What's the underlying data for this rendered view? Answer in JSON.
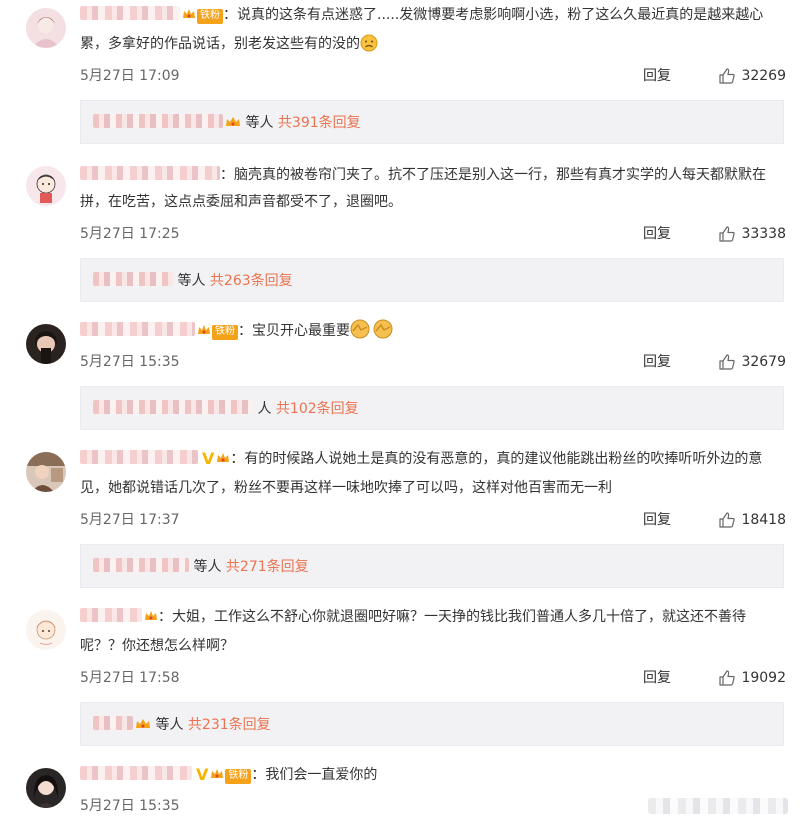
{
  "comments": [
    {
      "badge_text": "铁粉",
      "text": "：说真的这条有点迷惑了.....发微博要考虑影响啊小选，粉了这么久最近真的是越来越心累，多拿好的作品说话，别老发这些有的没的",
      "emoji": "disappointed-emoji",
      "time": "5月27日 17:09",
      "reply_label": "回复",
      "likes": "32269",
      "thread": {
        "prefix": "等人",
        "count_text": "共391条回复"
      }
    },
    {
      "badge_text": "",
      "text": "：脑壳真的被卷帘门夹了。抗不了压还是别入这一行，那些有真才实学的人每天都默默在拼，在吃苦，这点点委屈和声音都受不了，退圈吧。",
      "time": "5月27日 17:25",
      "reply_label": "回复",
      "likes": "33338",
      "thread": {
        "prefix": "等人",
        "count_text": "共263条回复"
      }
    },
    {
      "badge_text": "铁粉",
      "text": "：宝贝开心最重要",
      "emoji": "hug-emoji",
      "time": "5月27日 15:35",
      "reply_label": "回复",
      "likes": "32679",
      "thread": {
        "prefix": "人",
        "count_text": "共102条回复"
      }
    },
    {
      "badge_text": "",
      "text": "：有的时候路人说她土是真的没有恶意的，真的建议他能跳出粉丝的吹捧听听外边的意见，她都说错话几次了，粉丝不要再这样一味地吹捧了可以吗，这样对他百害而无一利",
      "time": "5月27日 17:37",
      "reply_label": "回复",
      "likes": "18418",
      "thread": {
        "prefix": "等人",
        "count_text": "共271条回复"
      }
    },
    {
      "badge_text": "",
      "text": "：大姐，工作这么不舒心你就退圈吧好嘛？一天挣的钱比我们普通人多几十倍了，就这还不善待呢？？你还想怎么样啊？",
      "time": "5月27日 17:58",
      "reply_label": "回复",
      "likes": "19092",
      "thread": {
        "prefix": "等人",
        "count_text": "共231条回复"
      }
    },
    {
      "badge_text": "铁粉",
      "text": "：我们会一直爱你的",
      "time": "5月27日 15:35"
    }
  ],
  "colors": {
    "link": "#eb7350",
    "badge": "#f4a21a",
    "vip": "#f7b500",
    "reply_bg": "#f2f2f5"
  }
}
